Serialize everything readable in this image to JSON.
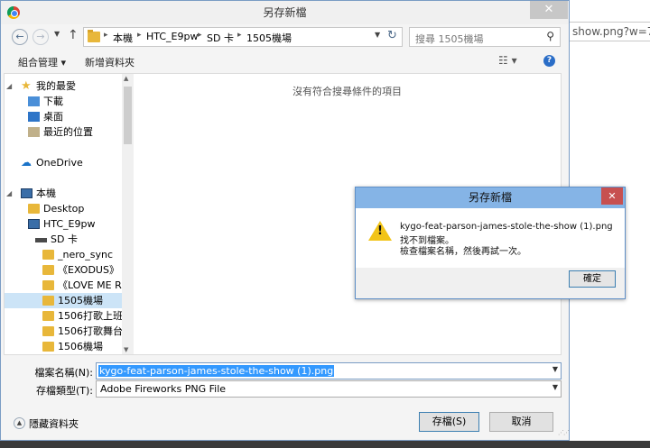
{
  "background": {
    "url_fragment": "show.png?w=7"
  },
  "dialog": {
    "title": "另存新檔",
    "close_glyph": "✕",
    "nav": {
      "back_glyph": "←",
      "forward_glyph": "→",
      "up_glyph": "↑",
      "breadcrumb": [
        "本機",
        "HTC_E9pw",
        "SD 卡",
        "1505機場"
      ],
      "search_placeholder": "搜尋 1505機場"
    },
    "toolbar": {
      "organize_label": "組合管理 ▾",
      "new_folder_label": "新增資料夾",
      "view_glyph": "☷ ▾",
      "help_glyph": "?"
    },
    "tree": [
      {
        "label": "我的最愛",
        "icon": "star-icon",
        "kind": "star",
        "indent": 0,
        "expander": "◢"
      },
      {
        "label": "下載",
        "icon": "downloads-icon",
        "kind": "download",
        "indent": 1
      },
      {
        "label": "桌面",
        "icon": "desktop-icon",
        "kind": "desktop",
        "indent": 1
      },
      {
        "label": "最近的位置",
        "icon": "recent-places-icon",
        "kind": "recent",
        "indent": 1
      },
      {
        "label": "OneDrive",
        "icon": "onedrive-icon",
        "kind": "cloud",
        "indent": 0,
        "gap": true
      },
      {
        "label": "本機",
        "icon": "computer-icon",
        "kind": "pc",
        "indent": 0,
        "expander": "◢",
        "gap": true
      },
      {
        "label": "Desktop",
        "icon": "folder-icon",
        "kind": "folder",
        "indent": 1
      },
      {
        "label": "HTC_E9pw",
        "icon": "phone-icon",
        "kind": "pc",
        "indent": 1
      },
      {
        "label": "SD 卡",
        "icon": "drive-icon",
        "kind": "drive",
        "indent": 2
      },
      {
        "label": "_nero_sync",
        "icon": "folder-icon",
        "kind": "folder",
        "indent": 3
      },
      {
        "label": "《EXODUS》",
        "icon": "folder-icon",
        "kind": "folder",
        "indent": 3
      },
      {
        "label": "《LOVE ME RIG",
        "icon": "folder-icon",
        "kind": "folder",
        "indent": 3
      },
      {
        "label": "1505機場",
        "icon": "folder-icon",
        "kind": "folder",
        "indent": 3,
        "selected": true
      },
      {
        "label": "1506打歌上班",
        "icon": "folder-icon",
        "kind": "folder",
        "indent": 3
      },
      {
        "label": "1506打歌舞台",
        "icon": "folder-icon",
        "kind": "folder",
        "indent": 3
      },
      {
        "label": "1506機場",
        "icon": "folder-icon",
        "kind": "folder",
        "indent": 3
      }
    ],
    "empty_message": "沒有符合搜尋條件的項目",
    "filename_label": "檔案名稱(N):",
    "filename_value": "kygo-feat-parson-james-stole-the-show (1).png",
    "filetype_label": "存檔類型(T):",
    "filetype_value": "Adobe Fireworks PNG File",
    "hide_folders_label": "隱藏資料夾",
    "save_label": "存檔(S)",
    "cancel_label": "取消"
  },
  "error_dialog": {
    "title": "另存新檔",
    "close_glyph": "✕",
    "message_lines": [
      "kygo-feat-parson-james-stole-the-show (1).png",
      "找不到檔案。",
      "檢查檔案名稱，然後再試一次。"
    ],
    "ok_label": "確定"
  }
}
